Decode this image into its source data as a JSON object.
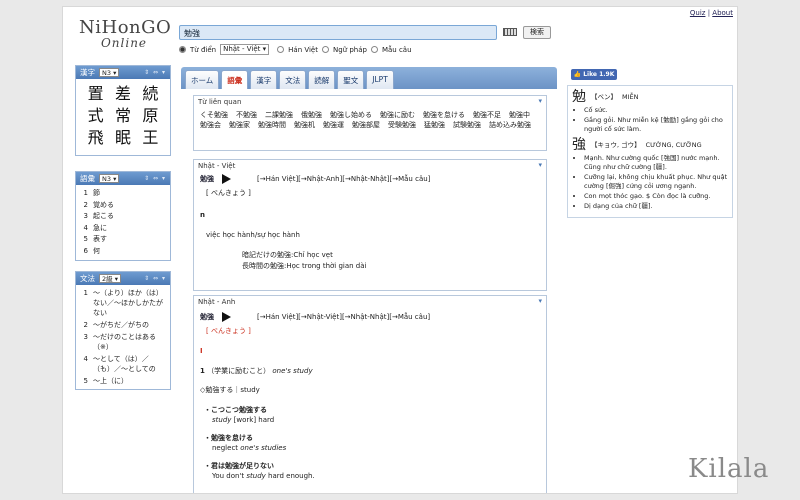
{
  "toplinks": {
    "quiz": "Quiz",
    "sep": "|",
    "about": "About"
  },
  "logo": {
    "line1": "NiHonGO",
    "line2": "Online"
  },
  "search": {
    "value": "勉強",
    "button": "検索"
  },
  "modes": {
    "tudien": "Từ điển",
    "dict_select": "Nhật - Việt ▾",
    "hanviet": "Hán Việt",
    "nguphap": "Ngữ pháp",
    "maucau": "Mẫu câu"
  },
  "kanji_panel": {
    "title": "漢字",
    "level": "N3 ▾",
    "controls": "⇕ ⇔ ▾",
    "chars": [
      "置",
      "差",
      "続",
      "式",
      "常",
      "原",
      "飛",
      "眠",
      "王"
    ]
  },
  "vocab_panel": {
    "title": "語彙",
    "level": "N3 ▾",
    "controls": "⇕ ⇔ ▾",
    "items": [
      {
        "n": "1",
        "t": "節"
      },
      {
        "n": "2",
        "t": "覚める"
      },
      {
        "n": "3",
        "t": "起こる"
      },
      {
        "n": "4",
        "t": "急に"
      },
      {
        "n": "5",
        "t": "表す"
      },
      {
        "n": "6",
        "t": "何"
      }
    ]
  },
  "grammar_panel": {
    "title": "文法",
    "level": "2級 ▾",
    "controls": "⇕ ⇔ ▾",
    "items": [
      {
        "n": "1",
        "t": "～（より）ほか（は）ない／～ほかしかたがない"
      },
      {
        "n": "2",
        "t": "～がちだ／がちの"
      },
      {
        "n": "3",
        "t": "～だけのことはある（※）"
      },
      {
        "n": "4",
        "t": "～として（は）／（も）／～としての"
      },
      {
        "n": "5",
        "t": "～上（に）"
      }
    ]
  },
  "tabs": [
    "ホーム",
    "語彙",
    "漢字",
    "文法",
    "読解",
    "聖文",
    "JLPT"
  ],
  "related": {
    "title": "Từ liên quan",
    "words": [
      "くそ勉強",
      "不勉強",
      "二課勉強",
      "俄勉強",
      "勉強し始める",
      "勉強に励む",
      "勉強を怠ける",
      "勉強不足",
      "勉強中",
      "勉強会",
      "勉強家",
      "勉強時間",
      "勉強机",
      "勉強運",
      "勉強部屋",
      "受験勉強",
      "猛勉強",
      "試験勉強",
      "詰め込み勉強"
    ]
  },
  "nv": {
    "title": "Nhật - Việt",
    "word": "勉強",
    "links": "[→Hán Việt][→Nhật-Anh][→Nhật-Nhật][→Mẫu câu]",
    "reading": "[ べんきょう ]",
    "pos": "n",
    "meaning": "việc học hành/sự học hành",
    "examples": [
      {
        "jp": "暗記だけの勉強",
        "vi": ":Chỉ học vẹt"
      },
      {
        "jp": "長時間の勉強",
        "vi": ":Học trong thời gian dài"
      }
    ]
  },
  "na": {
    "title": "Nhật - Anh",
    "word": "勉強",
    "links": "[→Hán Việt][→Nhật-Việt][→Nhật-Nhật][→Mẫu câu]",
    "reading": "[ べんきょう ]",
    "pos": "I",
    "sense_num": "1",
    "sense_jp": "（学業に励むこと）",
    "sense_en": "one's study",
    "compound": "◇勉強する｜study",
    "examples": [
      {
        "jp": "・こつこつ勉強する",
        "en_i": "study",
        "en_r": " [work] hard"
      },
      {
        "jp": "・勉強を怠ける",
        "en_r": "neglect ",
        "en_i": "one's studies"
      },
      {
        "jp": "・君は勉強が足りない",
        "en_r": "You don't ",
        "en_i": "study",
        "en_r2": " hard enough."
      }
    ]
  },
  "fb": "👍 Like 1.9K",
  "kanji_info": [
    {
      "char": "勉",
      "on": "【ベン】",
      "hv": "MIỄN",
      "bullets": [
        "Cố sức.",
        "Gắng gỏi. Như miễn kệ [勉励] gắng gỏi cho người cố sức làm."
      ]
    },
    {
      "char": "強",
      "on": "【キョウ, ゴウ】",
      "hv": "CƯỜNG, CƯỠNG",
      "bullets": [
        "Mạnh. Như cường quốc [強国] nước mạnh. Cũng như chữ cường [疆].",
        "Cưỡng lại, không chịu khuất phục. Như quật cường [倔強] cứng cỏi ương ngạnh.",
        "Con mọt thóc gạo. $ Còn đọc là cưỡng.",
        "Dị dạng của chữ [疆]."
      ]
    }
  ],
  "watermark": "Kilala"
}
